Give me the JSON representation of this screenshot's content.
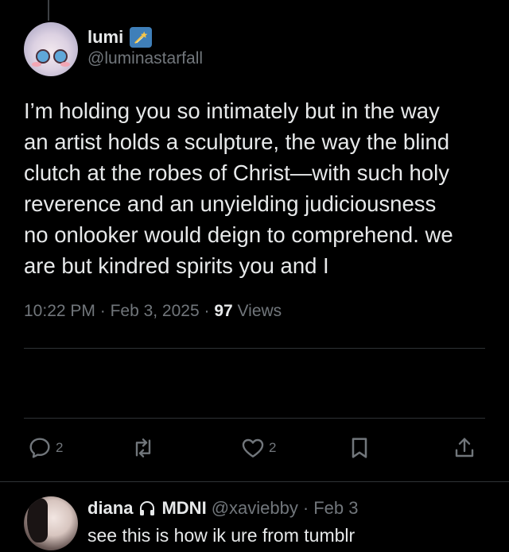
{
  "colors": {
    "background": "#000000",
    "text_primary": "#e7e9ea",
    "text_secondary": "#71767b",
    "divider": "#2f3336",
    "badge": "#3f7fb9"
  },
  "tweet": {
    "author": {
      "display_name": "lumi",
      "handle": "@luminastarfall",
      "badge_icon": "shooting-star-icon"
    },
    "text": "I’m holding you so intimately but in the way\nan artist holds a sculpture, the way the blind\nclutch at the robes of Christ—with such holy\nreverence and an unyielding judiciousness\nno onlooker would deign to comprehend. we\nare but kindred spirits you and I",
    "time": "10:22 PM",
    "sep1": " · ",
    "date": "Feb 3, 2025",
    "sep2": " · ",
    "views_count": "97",
    "views_label": "Views"
  },
  "actions": {
    "reply": {
      "icon": "reply-icon",
      "count": "2"
    },
    "retweet": {
      "icon": "retweet-icon",
      "count": ""
    },
    "like": {
      "icon": "heart-icon",
      "count": "2"
    },
    "bookmark": {
      "icon": "bookmark-icon"
    },
    "share": {
      "icon": "share-icon"
    }
  },
  "reply": {
    "display_name": "diana",
    "name_icon": "headphones-icon",
    "name_suffix": "MDNI",
    "handle": "@xaviebby",
    "sep": " · ",
    "date": "Feb 3",
    "text": "see this is how ik ure from tumblr"
  }
}
